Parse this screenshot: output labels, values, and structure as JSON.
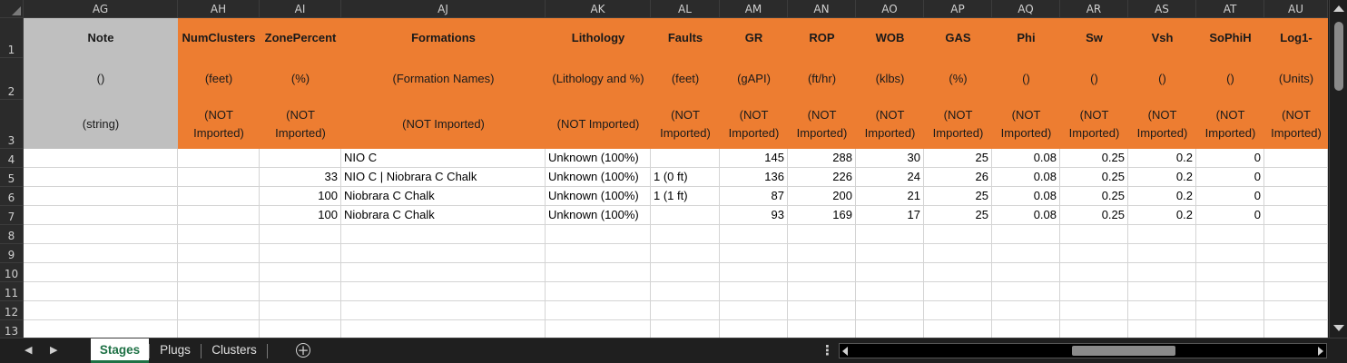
{
  "columns": [
    "AG",
    "AH",
    "AI",
    "AJ",
    "AK",
    "AL",
    "AM",
    "AN",
    "AO",
    "AP",
    "AQ",
    "AR",
    "AS",
    "AT",
    "AU"
  ],
  "header": {
    "names": [
      "Note",
      "NumClusters",
      "ZonePercent",
      "Formations",
      "Lithology",
      "Faults",
      "GR",
      "ROP",
      "WOB",
      "GAS",
      "Phi",
      "Sw",
      "Vsh",
      "SoPhiH",
      "Log1-"
    ],
    "units": [
      "()",
      "(feet)",
      "(%)",
      "(Formation Names)",
      "(Lithology and %)",
      "(feet)",
      "(gAPI)",
      "(ft/hr)",
      "(klbs)",
      "(%)",
      "()",
      "()",
      "()",
      "()",
      "(Units)"
    ],
    "import_status": [
      "(string)",
      "(NOT Imported)",
      "(NOT Imported)",
      "(NOT Imported)",
      "(NOT Imported)",
      "(NOT Imported)",
      "(NOT Imported)",
      "(NOT Imported)",
      "(NOT Imported)",
      "(NOT Imported)",
      "(NOT Imported)",
      "(NOT Imported)",
      "(NOT Imported)",
      "(NOT Imported)",
      "(NOT Imported)"
    ]
  },
  "row_numbers": [
    "1",
    "2",
    "3",
    "4",
    "5",
    "6",
    "7",
    "8",
    "9",
    "10",
    "11",
    "12",
    "13"
  ],
  "rows": [
    [
      "",
      "",
      "",
      "NIO C",
      "Unknown (100%)",
      "",
      "145",
      "288",
      "30",
      "25",
      "0.08",
      "0.25",
      "0.2",
      "0",
      ""
    ],
    [
      "",
      "",
      "33",
      "NIO C | Niobrara C Chalk",
      "Unknown (100%)",
      "1 (0 ft)",
      "136",
      "226",
      "24",
      "26",
      "0.08",
      "0.25",
      "0.2",
      "0",
      ""
    ],
    [
      "",
      "",
      "100",
      "Niobrara C Chalk",
      "Unknown (100%)",
      "1 (1 ft)",
      "87",
      "200",
      "21",
      "25",
      "0.08",
      "0.25",
      "0.2",
      "0",
      ""
    ],
    [
      "",
      "",
      "100",
      "Niobrara C Chalk",
      "Unknown (100%)",
      "",
      "93",
      "169",
      "17",
      "25",
      "0.08",
      "0.25",
      "0.2",
      "0",
      ""
    ],
    [
      "",
      "",
      "",
      "",
      "",
      "",
      "",
      "",
      "",
      "",
      "",
      "",
      "",
      "",
      ""
    ],
    [
      "",
      "",
      "",
      "",
      "",
      "",
      "",
      "",
      "",
      "",
      "",
      "",
      "",
      "",
      ""
    ],
    [
      "",
      "",
      "",
      "",
      "",
      "",
      "",
      "",
      "",
      "",
      "",
      "",
      "",
      "",
      ""
    ],
    [
      "",
      "",
      "",
      "",
      "",
      "",
      "",
      "",
      "",
      "",
      "",
      "",
      "",
      "",
      ""
    ],
    [
      "",
      "",
      "",
      "",
      "",
      "",
      "",
      "",
      "",
      "",
      "",
      "",
      "",
      "",
      ""
    ],
    [
      "",
      "",
      "",
      "",
      "",
      "",
      "",
      "",
      "",
      "",
      "",
      "",
      "",
      "",
      ""
    ]
  ],
  "sheet_tabs": [
    "Stages",
    "Plugs",
    "Clusters"
  ],
  "active_tab": "Stages",
  "colors": {
    "header_orange": "#ed7d31",
    "header_grey": "#bfbfbf",
    "active_tab_green": "#1e7145"
  }
}
